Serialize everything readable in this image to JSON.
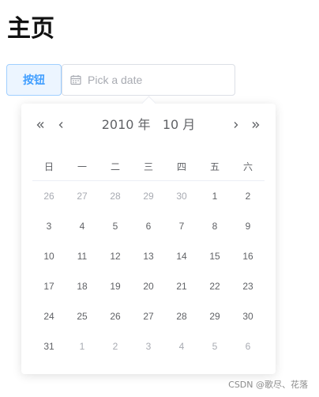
{
  "page": {
    "title": "主页"
  },
  "toolbar": {
    "button_label": "按钮"
  },
  "date_input": {
    "placeholder": "Pick a date",
    "value": ""
  },
  "picker": {
    "year_label": "2010 年",
    "month_label": "10 月",
    "weekdays": [
      "日",
      "一",
      "二",
      "三",
      "四",
      "五",
      "六"
    ],
    "weeks": [
      [
        {
          "d": "26",
          "other": true
        },
        {
          "d": "27",
          "other": true
        },
        {
          "d": "28",
          "other": true
        },
        {
          "d": "29",
          "other": true
        },
        {
          "d": "30",
          "other": true
        },
        {
          "d": "1",
          "other": false
        },
        {
          "d": "2",
          "other": false
        }
      ],
      [
        {
          "d": "3",
          "other": false
        },
        {
          "d": "4",
          "other": false
        },
        {
          "d": "5",
          "other": false
        },
        {
          "d": "6",
          "other": false
        },
        {
          "d": "7",
          "other": false
        },
        {
          "d": "8",
          "other": false
        },
        {
          "d": "9",
          "other": false
        }
      ],
      [
        {
          "d": "10",
          "other": false
        },
        {
          "d": "11",
          "other": false
        },
        {
          "d": "12",
          "other": false
        },
        {
          "d": "13",
          "other": false
        },
        {
          "d": "14",
          "other": false
        },
        {
          "d": "15",
          "other": false
        },
        {
          "d": "16",
          "other": false
        }
      ],
      [
        {
          "d": "17",
          "other": false
        },
        {
          "d": "18",
          "other": false
        },
        {
          "d": "19",
          "other": false
        },
        {
          "d": "20",
          "other": false
        },
        {
          "d": "21",
          "other": false
        },
        {
          "d": "22",
          "other": false
        },
        {
          "d": "23",
          "other": false
        }
      ],
      [
        {
          "d": "24",
          "other": false
        },
        {
          "d": "25",
          "other": false
        },
        {
          "d": "26",
          "other": false
        },
        {
          "d": "27",
          "other": false
        },
        {
          "d": "28",
          "other": false
        },
        {
          "d": "29",
          "other": false
        },
        {
          "d": "30",
          "other": false
        }
      ],
      [
        {
          "d": "31",
          "other": false
        },
        {
          "d": "1",
          "other": true
        },
        {
          "d": "2",
          "other": true
        },
        {
          "d": "3",
          "other": true
        },
        {
          "d": "4",
          "other": true
        },
        {
          "d": "5",
          "other": true
        },
        {
          "d": "6",
          "other": true
        }
      ]
    ]
  },
  "watermark": "CSDN @歌尽、花落",
  "colors": {
    "accent": "#409eff",
    "accent_bg": "#ecf5ff",
    "text": "#606266",
    "muted": "#a8abb2"
  }
}
